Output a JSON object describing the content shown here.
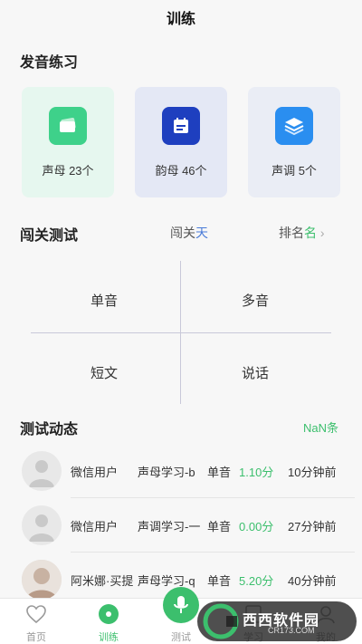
{
  "header": {
    "title": "训练"
  },
  "practice": {
    "title": "发音练习",
    "cards": [
      {
        "label": "声母 23个",
        "bg": "#e6f7ef",
        "icon_bg": "#3ed18a",
        "icon": "cards-icon"
      },
      {
        "label": "韵母 46个",
        "bg": "#e4e8f5",
        "icon_bg": "#1e3fbf",
        "icon": "calendar-icon"
      },
      {
        "label": "声调 5个",
        "bg": "#eaedf5",
        "icon_bg": "#2a8ef0",
        "icon": "layers-icon"
      }
    ]
  },
  "challenge": {
    "title": "闯关测试",
    "level_prefix": "闯关",
    "level_value": "天",
    "rank_prefix": "排名",
    "rank_suffix": "名",
    "rank_arrow": "›",
    "options": [
      "单音",
      "多音",
      "短文",
      "说话"
    ]
  },
  "dynamics": {
    "title": "测试动态",
    "count": "NaN条",
    "rows": [
      {
        "user": "微信用户",
        "item": "声母学习-b",
        "type": "单音",
        "score": "1.10分",
        "time": "10分钟前",
        "avatar": "default"
      },
      {
        "user": "微信用户",
        "item": "声调学习-一",
        "type": "单音",
        "score": "0.00分",
        "time": "27分钟前",
        "avatar": "default"
      },
      {
        "user": "阿米娜·买提",
        "item": "声母学习-q",
        "type": "单音",
        "score": "5.20分",
        "time": "40分钟前",
        "avatar": "photo"
      }
    ]
  },
  "tabbar": {
    "tabs": [
      {
        "label": "首页",
        "icon": "heart-icon",
        "active": false
      },
      {
        "label": "训练",
        "icon": "target-icon",
        "active": true
      },
      {
        "label": "测试",
        "icon": "mic-icon",
        "active": false
      },
      {
        "label": "学习",
        "icon": "book-icon",
        "active": false
      },
      {
        "label": "我的",
        "icon": "user-icon",
        "active": false
      }
    ]
  },
  "watermark": {
    "text": "西西软件园",
    "sub": "CR173.COM"
  },
  "colors": {
    "accent": "#3cbf6d",
    "blue": "#4a7bd8"
  }
}
